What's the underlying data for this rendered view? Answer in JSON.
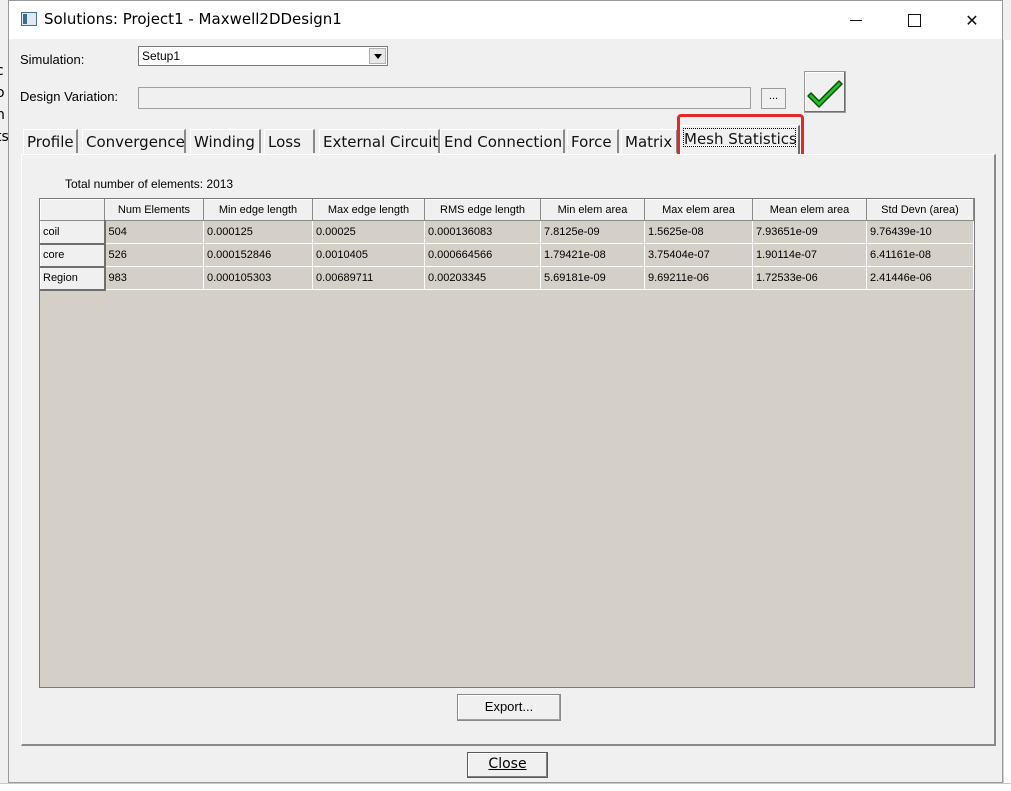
{
  "background": {
    "left_fragments": [
      "c",
      "o",
      "n",
      "ts"
    ]
  },
  "window": {
    "title": "Solutions: Project1 - Maxwell2DDesign1",
    "minimize_glyph": "",
    "maximize_glyph": "",
    "close_glyph": "✕"
  },
  "form": {
    "simulation_label": "Simulation:",
    "simulation_value": "Setup1",
    "design_variation_label": "Design Variation:",
    "design_variation_value": "",
    "browse_label": "...",
    "status_icon": "green-checkmark-icon",
    "status_color": "#22c322"
  },
  "tabs": [
    {
      "label": "Profile",
      "active": false
    },
    {
      "label": "Convergence",
      "active": false
    },
    {
      "label": "Winding",
      "active": false
    },
    {
      "label": "Loss",
      "active": false
    },
    {
      "label": "External Circuit",
      "active": false
    },
    {
      "label": "End Connection",
      "active": false
    },
    {
      "label": "Force",
      "active": false
    },
    {
      "label": "Matrix",
      "active": false
    },
    {
      "label": "Mesh Statistics",
      "active": true
    }
  ],
  "highlight_color": "#e02a2a",
  "mesh": {
    "total_label": "Total number of elements:  2013",
    "columns": [
      "Num Elements",
      "Min edge length",
      "Max edge length",
      "RMS edge length",
      "Min elem area",
      "Max elem area",
      "Mean elem area",
      "Std Devn (area)"
    ],
    "rows": [
      {
        "name": "coil",
        "values": [
          "504",
          "0.000125",
          "0.00025",
          "0.000136083",
          "7.8125e-09",
          "1.5625e-08",
          "7.93651e-09",
          "9.76439e-10"
        ]
      },
      {
        "name": "core",
        "values": [
          "526",
          "0.000152846",
          "0.0010405",
          "0.000664566",
          "1.79421e-08",
          "3.75404e-07",
          "1.90114e-07",
          "6.41161e-08"
        ]
      },
      {
        "name": "Region",
        "values": [
          "983",
          "0.000105303",
          "0.00689711",
          "0.00203345",
          "5.69181e-09",
          "9.69211e-06",
          "1.72533e-06",
          "2.41446e-06"
        ]
      }
    ]
  },
  "buttons": {
    "export_label": "Export...",
    "close_label": "Close"
  }
}
